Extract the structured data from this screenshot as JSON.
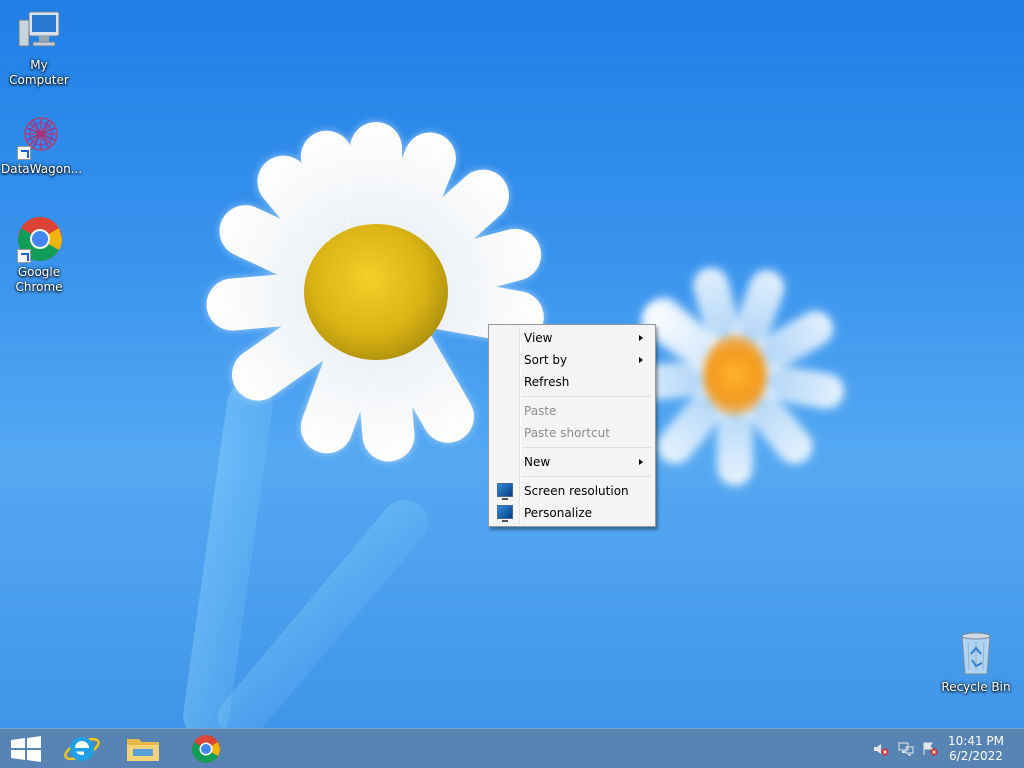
{
  "desktop": {
    "icons": [
      {
        "label": "My Computer",
        "icon": "computer-icon"
      },
      {
        "label": "DataWagon...",
        "icon": "datawagon-icon"
      },
      {
        "label": "Google Chrome",
        "icon": "chrome-icon"
      },
      {
        "label": "Recycle Bin",
        "icon": "recycle-bin-icon"
      }
    ]
  },
  "context_menu": {
    "items": [
      {
        "label": "View",
        "submenu": true
      },
      {
        "label": "Sort by",
        "submenu": true
      },
      {
        "label": "Refresh"
      },
      {
        "label": "Paste",
        "disabled": true
      },
      {
        "label": "Paste shortcut",
        "disabled": true
      },
      {
        "label": "New",
        "submenu": true
      },
      {
        "label": "Screen resolution",
        "icon": "monitor-icon"
      },
      {
        "label": "Personalize",
        "icon": "monitor-icon"
      }
    ]
  },
  "taskbar": {
    "pinned": [
      {
        "name": "start",
        "icon": "windows-logo-icon"
      },
      {
        "name": "internet-explorer",
        "icon": "ie-icon"
      },
      {
        "name": "file-explorer",
        "icon": "folder-icon"
      },
      {
        "name": "chrome",
        "icon": "chrome-icon"
      }
    ],
    "tray": [
      "volume-muted-icon",
      "network-icon",
      "action-center-icon"
    ],
    "time": "10:41 PM",
    "date": "6/2/2022"
  },
  "colors": {
    "taskbar": "#5a82af",
    "menu_bg": "#f5f5f5",
    "disabled_text": "#8c8c8c"
  }
}
